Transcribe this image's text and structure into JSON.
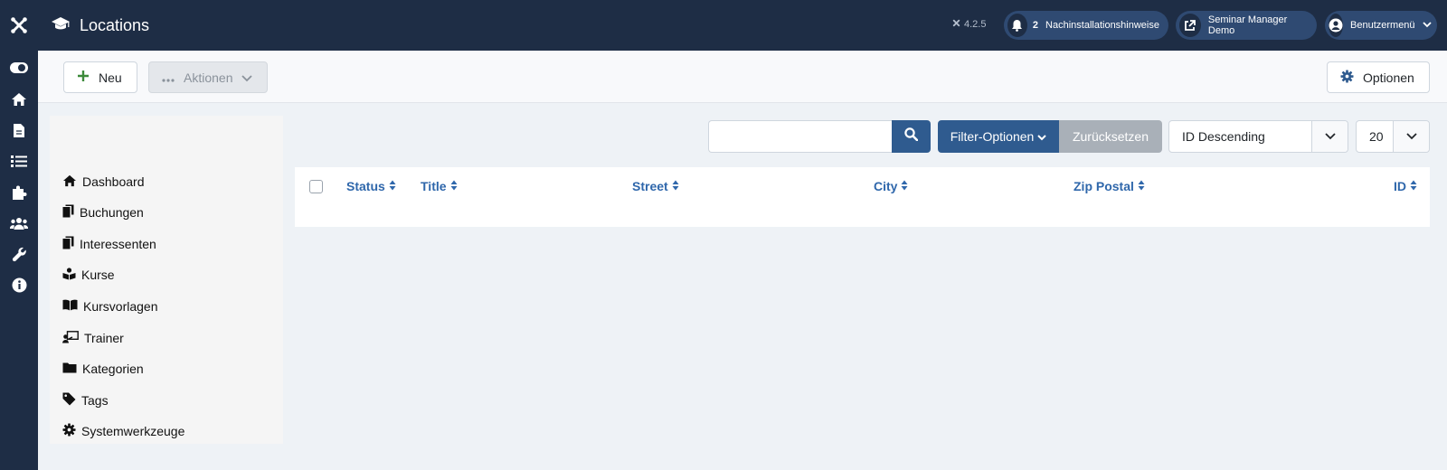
{
  "header": {
    "title": "Locations",
    "version": "4.2.5",
    "notifications_count": "2",
    "post_install_label": "Nachinstallationshinweise",
    "site_label": "Seminar Manager Demo",
    "user_menu_label": "Benutzermenü"
  },
  "toolbar": {
    "new_label": "Neu",
    "actions_label": "Aktionen",
    "options_label": "Optionen"
  },
  "sidebar": {
    "items": [
      {
        "label": "Dashboard",
        "icon": "home-icon"
      },
      {
        "label": "Buchungen",
        "icon": "copy-icon"
      },
      {
        "label": "Interessenten",
        "icon": "copy-icon"
      },
      {
        "label": "Kurse",
        "icon": "book-reader-icon"
      },
      {
        "label": "Kursvorlagen",
        "icon": "book-open-icon"
      },
      {
        "label": "Trainer",
        "icon": "chalkboard-teacher-icon"
      },
      {
        "label": "Kategorien",
        "icon": "folder-icon"
      },
      {
        "label": "Tags",
        "icon": "tag-icon"
      },
      {
        "label": "Systemwerkzeuge",
        "icon": "cog-icon"
      }
    ]
  },
  "filters": {
    "search_placeholder": "",
    "filter_options_label": "Filter-Optionen",
    "reset_label": "Zurücksetzen",
    "ordering_value": "ID Descending",
    "limit_value": "20"
  },
  "table": {
    "columns": [
      "Status",
      "Title",
      "Street",
      "City",
      "Zip Postal",
      "ID"
    ],
    "rows": []
  },
  "colors": {
    "header_bg": "#1e2d45",
    "primary": "#2f5b8f",
    "link": "#2f67ab",
    "reset_bg": "#a9b0b8"
  }
}
